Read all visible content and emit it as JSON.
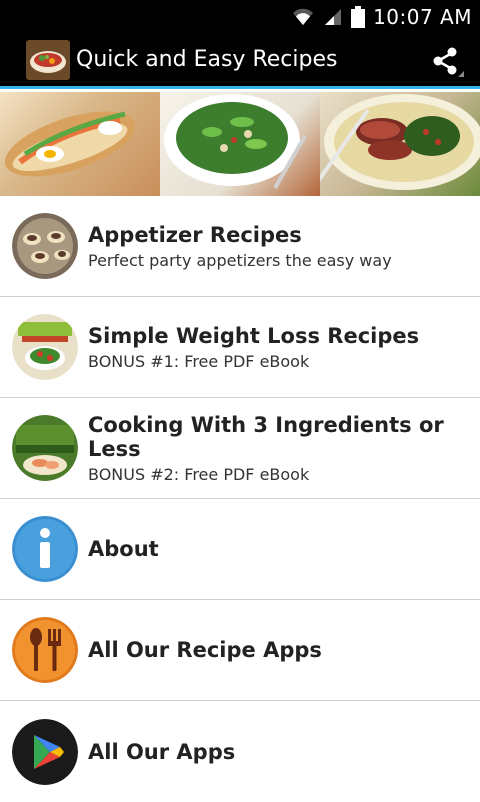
{
  "status_bar": {
    "time": "10:07 AM",
    "icons": [
      "wifi-icon",
      "signal-icon",
      "battery-icon"
    ]
  },
  "action_bar": {
    "title": "Quick and Easy Recipes",
    "app_icon": "recipe-bowl-icon",
    "share_icon": "share-icon"
  },
  "banner": {
    "images": [
      "sandwich-photo",
      "salad-bowl-photo",
      "steak-greens-photo"
    ]
  },
  "menu": {
    "items": [
      {
        "title": "Appetizer Recipes",
        "subtitle": "Perfect party appetizers the easy way",
        "icon": "appetizer-thumb"
      },
      {
        "title": "Simple Weight Loss Recipes",
        "subtitle": "BONUS #1: Free PDF eBook",
        "icon": "weight-loss-ebook-thumb"
      },
      {
        "title": "Cooking With 3 Ingredients or Less",
        "subtitle": "BONUS #2: Free PDF eBook",
        "icon": "cooking-ebook-thumb"
      },
      {
        "title": "About",
        "subtitle": "",
        "icon": "info-icon"
      },
      {
        "title": "All Our Recipe Apps",
        "subtitle": "",
        "icon": "fork-spoon-icon"
      },
      {
        "title": "All Our Apps",
        "subtitle": "",
        "icon": "play-store-icon"
      }
    ]
  },
  "colors": {
    "accent": "#33b5e5",
    "status_bg": "#000000",
    "divider": "#cfcfcf",
    "info_blue": "#3a8fd0",
    "recipe_orange": "#e07a1c"
  }
}
